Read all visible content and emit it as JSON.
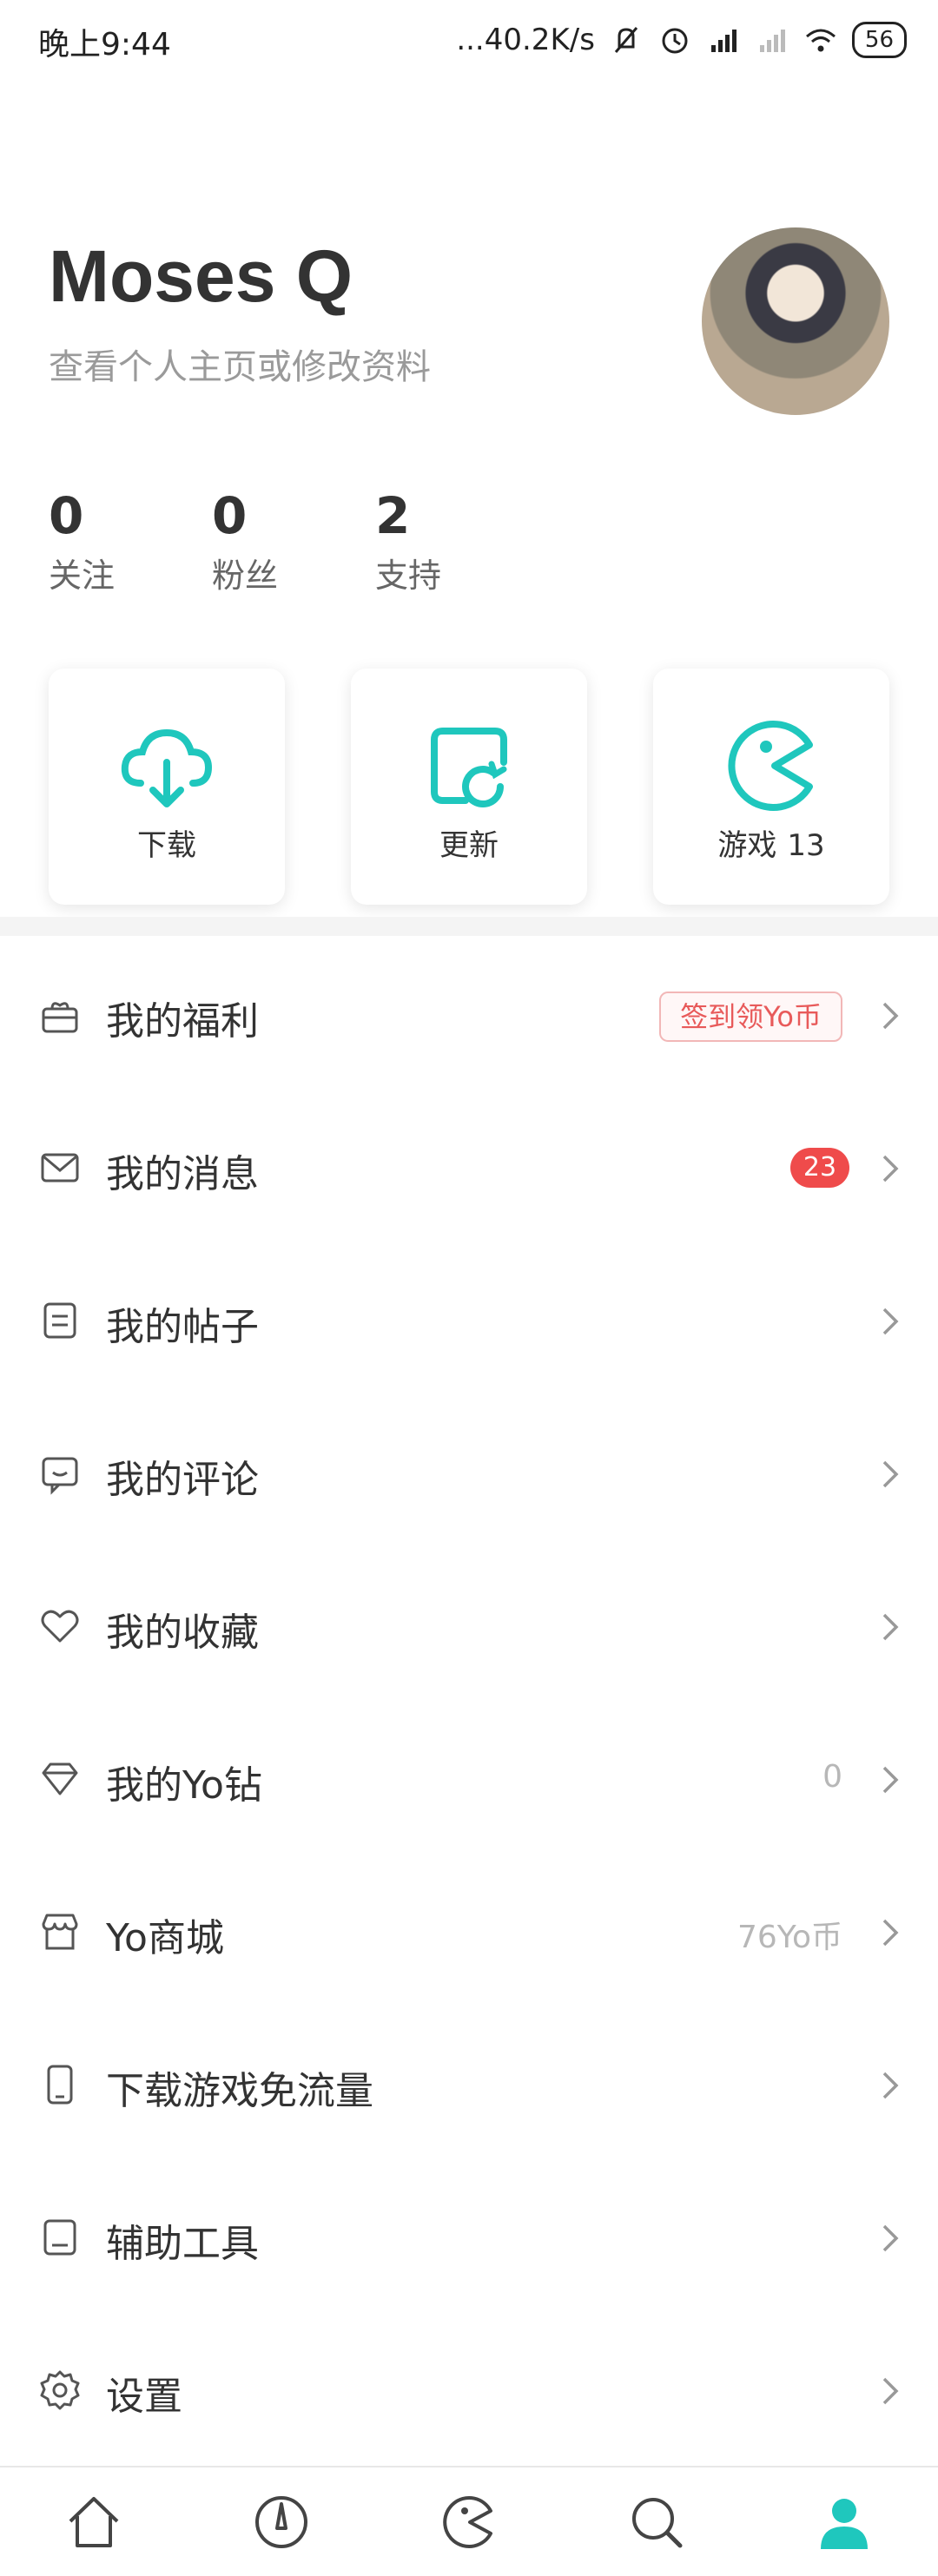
{
  "status_bar": {
    "time": "晚上9:44",
    "net_speed": "...40.2K/s",
    "battery": "56",
    "icons": [
      "mute-icon",
      "alarm-icon",
      "hd-signal-icon",
      "signal-icon",
      "wifi-icon",
      "battery-icon"
    ]
  },
  "profile": {
    "name": "Moses Q",
    "subtitle": "查看个人主页或修改资料",
    "stats": [
      {
        "value": "0",
        "label": "关注"
      },
      {
        "value": "0",
        "label": "粉丝"
      },
      {
        "value": "2",
        "label": "支持"
      }
    ]
  },
  "shortcuts": [
    {
      "label": "下载",
      "icon": "cloud-download-icon"
    },
    {
      "label": "更新",
      "icon": "update-icon"
    },
    {
      "label": "游戏",
      "count": "13",
      "icon": "pacman-icon"
    }
  ],
  "menu": [
    {
      "label": "我的福利",
      "icon": "gift-icon",
      "extra": "签到领Yo币"
    },
    {
      "label": "我的消息",
      "icon": "mail-icon",
      "badge": "23"
    },
    {
      "label": "我的帖子",
      "icon": "post-icon"
    },
    {
      "label": "我的评论",
      "icon": "comment-icon"
    },
    {
      "label": "我的收藏",
      "icon": "heart-icon"
    },
    {
      "label": "我的Yo钻",
      "icon": "diamond-icon",
      "value": "0"
    },
    {
      "label": "Yo商城",
      "icon": "shop-icon",
      "value": "76Yo币"
    },
    {
      "label": "下载游戏免流量",
      "icon": "phone-icon"
    },
    {
      "label": "辅助工具",
      "icon": "tools-icon"
    },
    {
      "label": "设置",
      "icon": "gear-icon"
    }
  ],
  "bottom_nav": [
    "home-icon",
    "discover-icon",
    "game-icon",
    "search-icon",
    "profile-icon"
  ],
  "colors": {
    "accent": "#1fc7bd",
    "badge": "#ef4b4b",
    "pill_text": "#e85a5a"
  }
}
